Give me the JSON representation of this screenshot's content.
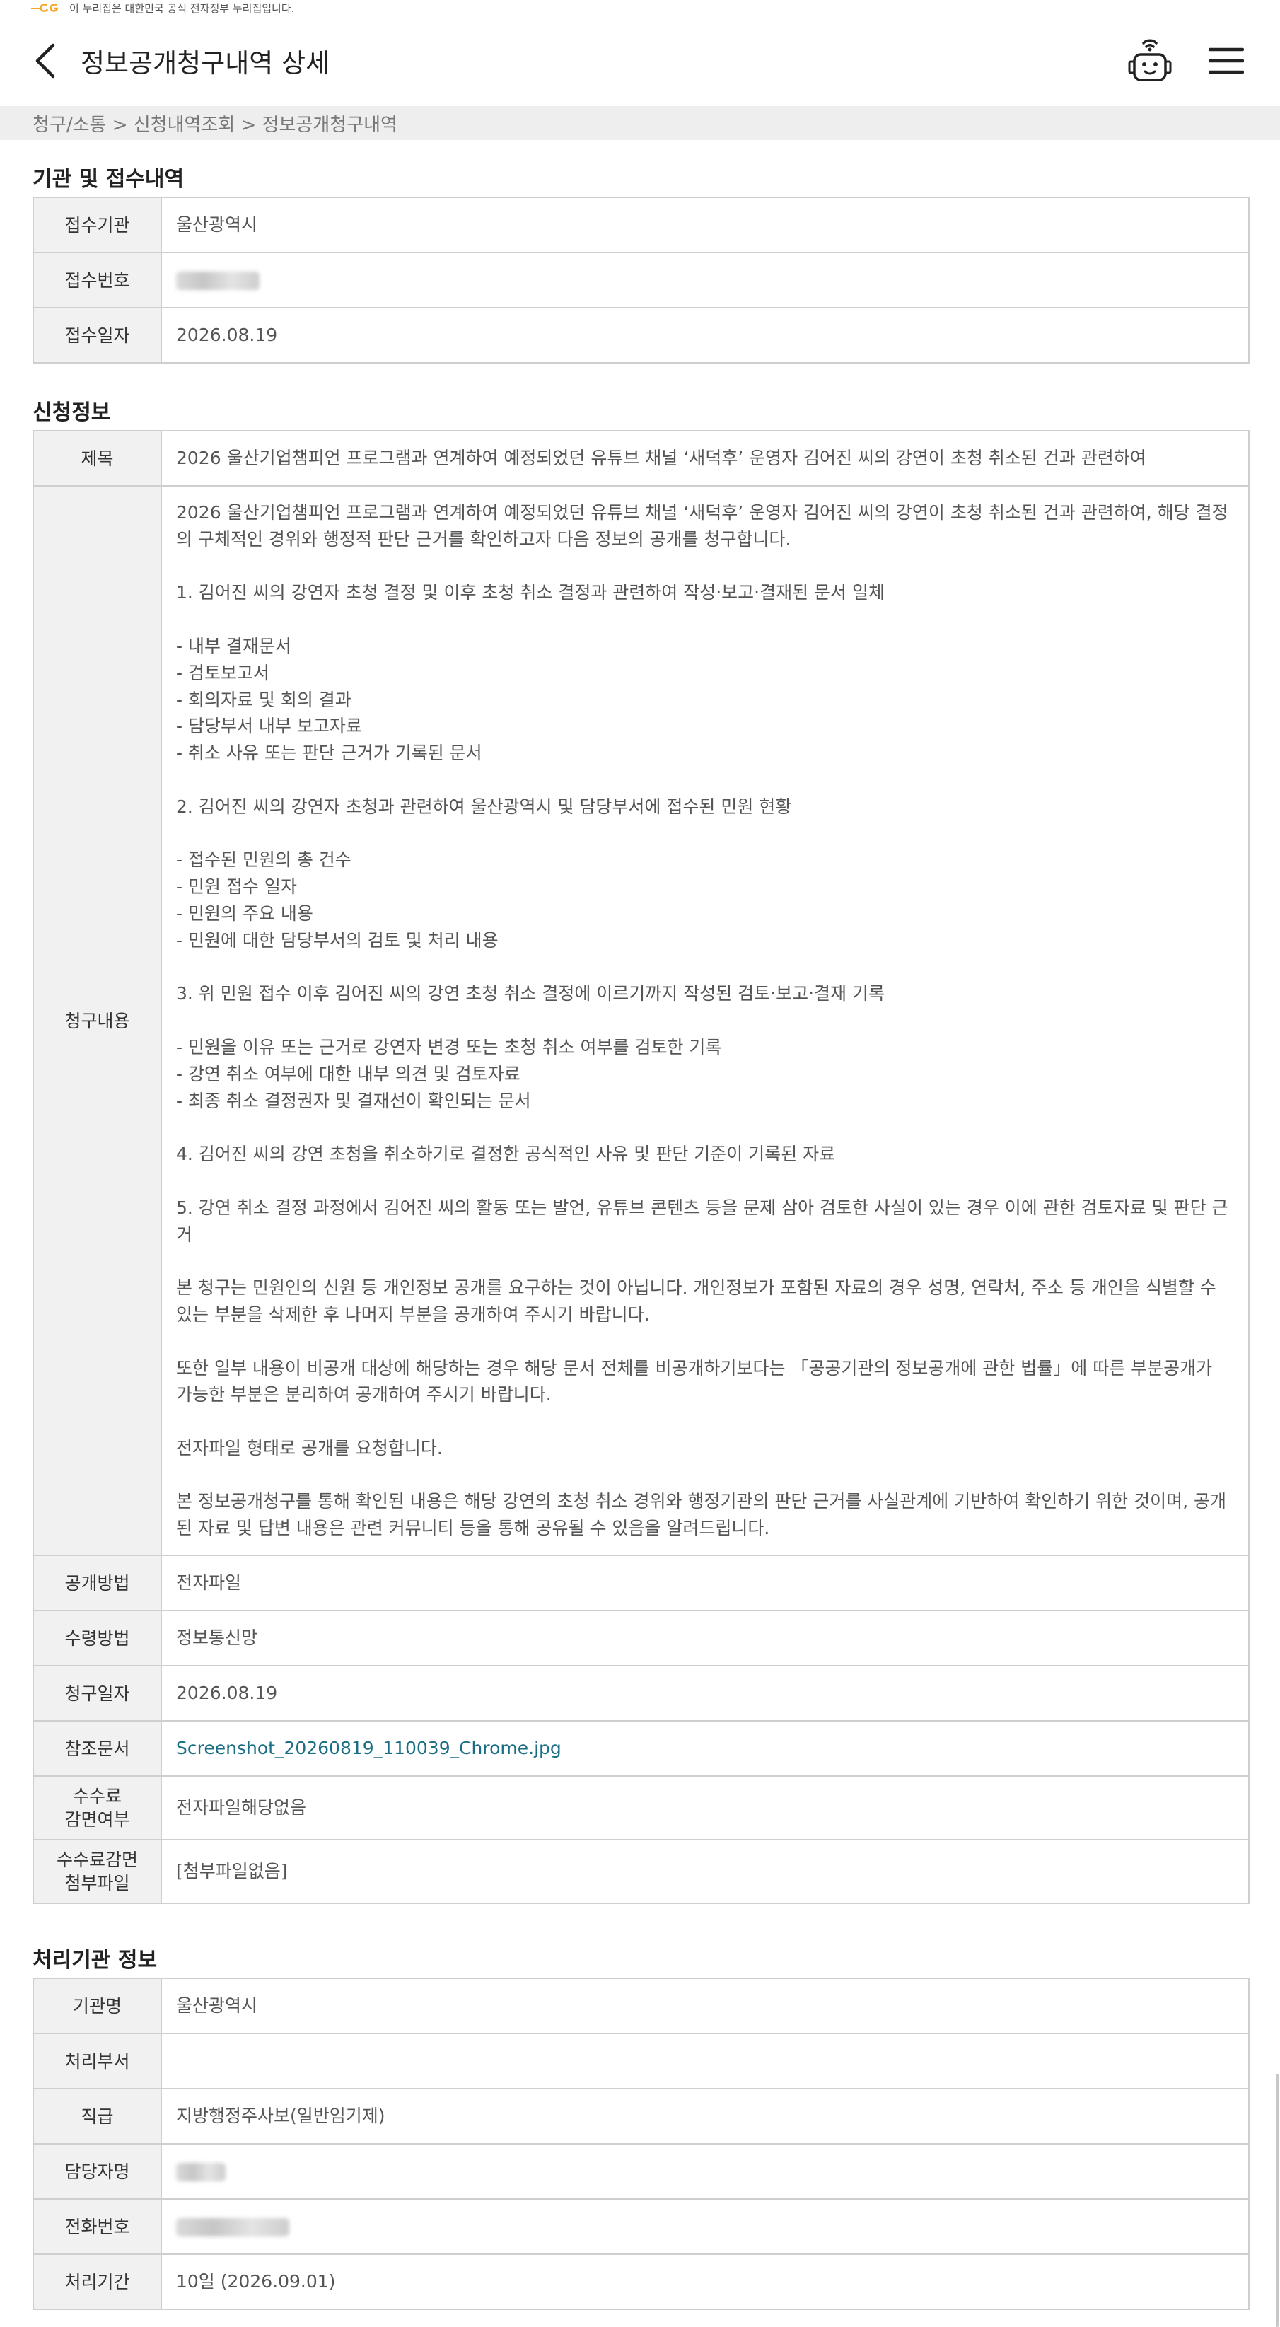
{
  "gov_banner": {
    "text": "이 누리집은 대한민국 공식 전자정부 누리집입니다."
  },
  "header": {
    "title": "정보공개청구내역 상세"
  },
  "breadcrumb": "청구/소통 > 신청내역조회 > 정보공개청구내역",
  "section1": {
    "title": "기관 및 접수내역",
    "rows": [
      {
        "label": "접수기관",
        "value": "울산광역시"
      },
      {
        "label": "접수번호",
        "value": ""
      },
      {
        "label": "접수일자",
        "value": "2026.08.19"
      }
    ]
  },
  "section2": {
    "title": "신청정보",
    "subject_label": "제목",
    "subject": "2026 울산기업챔피언 프로그램과 연계하여 예정되었던 유튜브 채널 ‘새덕후’ 운영자 김어진 씨의 강연이 초청 취소된 건과 관련하여",
    "content_label": "청구내용",
    "content": "2026 울산기업챔피언 프로그램과 연계하여 예정되었던 유튜브 채널 ‘새덕후’ 운영자 김어진 씨의 강연이 초청 취소된 건과 관련하여, 해당 결정의 구체적인 경위와 행정적 판단 근거를 확인하고자 다음 정보의 공개를 청구합니다.\n\n1. 김어진 씨의 강연자 초청 결정 및 이후 초청 취소 결정과 관련하여 작성·보고·결재된 문서 일체\n\n- 내부 결재문서\n- 검토보고서\n- 회의자료 및 회의 결과\n- 담당부서 내부 보고자료\n- 취소 사유 또는 판단 근거가 기록된 문서\n\n2. 김어진 씨의 강연자 초청과 관련하여 울산광역시 및 담당부서에 접수된 민원 현황\n\n- 접수된 민원의 총 건수\n- 민원 접수 일자\n- 민원의 주요 내용\n- 민원에 대한 담당부서의 검토 및 처리 내용\n\n3. 위 민원 접수 이후 김어진 씨의 강연 초청 취소 결정에 이르기까지 작성된 검토·보고·결재 기록\n\n- 민원을 이유 또는 근거로 강연자 변경 또는 초청 취소 여부를 검토한 기록\n- 강연 취소 여부에 대한 내부 의견 및 검토자료\n- 최종 취소 결정권자 및 결재선이 확인되는 문서\n\n4. 김어진 씨의 강연 초청을 취소하기로 결정한 공식적인 사유 및 판단 기준이 기록된 자료\n\n5. 강연 취소 결정 과정에서 김어진 씨의 활동 또는 발언, 유튜브 콘텐츠 등을 문제 삼아 검토한 사실이 있는 경우 이에 관한 검토자료 및 판단 근거\n\n본 청구는 민원인의 신원 등 개인정보 공개를 요구하는 것이 아닙니다. 개인정보가 포함된 자료의 경우 성명, 연락처, 주소 등 개인을 식별할 수 있는 부분을 삭제한 후 나머지 부분을 공개하여 주시기 바랍니다.\n\n또한 일부 내용이 비공개 대상에 해당하는 경우 해당 문서 전체를 비공개하기보다는 「공공기관의 정보공개에 관한 법률」에 따른 부분공개가 가능한 부분은 분리하여 공개하여 주시기 바랍니다.\n\n전자파일 형태로 공개를 요청합니다.\n\n본 정보공개청구를 통해 확인된 내용은 해당 강연의 초청 취소 경위와 행정기관의 판단 근거를 사실관계에 기반하여 확인하기 위한 것이며, 공개된 자료 및 답변 내용은 관련 커뮤니티 등을 통해 공유될 수 있음을 알려드립니다.",
    "rows": [
      {
        "label": "공개방법",
        "value": "전자파일"
      },
      {
        "label": "수령방법",
        "value": "정보통신망"
      },
      {
        "label": "청구일자",
        "value": "2026.08.19"
      }
    ],
    "attachment_label": "참조문서",
    "attachment": "Screenshot_20260819_110039_Chrome.jpg",
    "fee_waiver_label": "수수료\n감면여부",
    "fee_waiver": "전자파일해당없음",
    "fee_attach_label": "수수료감면\n첨부파일",
    "fee_attach": "[첨부파일없음]"
  },
  "section3": {
    "title": "처리기관 정보",
    "rows": [
      {
        "label": "기관명",
        "value": "울산광역시"
      },
      {
        "label": "처리부서",
        "value": ""
      },
      {
        "label": "직급",
        "value": "지방행정주사보(일반임기제)"
      },
      {
        "label": "담당자명",
        "value": ""
      },
      {
        "label": "전화번호",
        "value": ""
      },
      {
        "label": "처리기간",
        "value": "10일 (2026.09.01)"
      }
    ]
  },
  "colors": {
    "accent": "#1a6e84",
    "label_bg": "#f1f1f1",
    "breadcrumb_bg": "#eeeeee",
    "logo_orange": "#f5a623"
  },
  "icons": [
    "back-arrow-icon",
    "chatbot-icon",
    "hamburger-menu-icon"
  ]
}
